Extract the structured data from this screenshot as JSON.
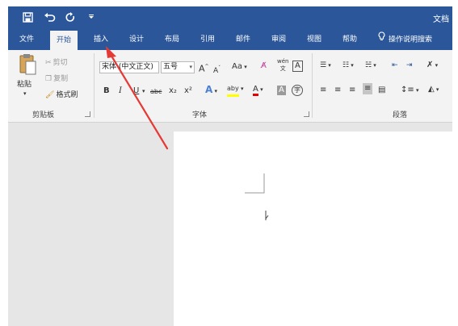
{
  "title_bar": {
    "save_icon": "save-icon",
    "undo_icon": "undo-icon",
    "redo_icon": "redo-icon",
    "customize_icon": "customize-qat-icon",
    "doc_title": "文档"
  },
  "tabs": [
    {
      "label": "文件"
    },
    {
      "label": "开始",
      "active": true
    },
    {
      "label": "插入"
    },
    {
      "label": "设计"
    },
    {
      "label": "布局"
    },
    {
      "label": "引用"
    },
    {
      "label": "邮件"
    },
    {
      "label": "审阅"
    },
    {
      "label": "视图"
    },
    {
      "label": "帮助"
    }
  ],
  "tell_me": {
    "label": "操作说明搜索",
    "icon": "lightbulb-icon"
  },
  "clipboard": {
    "paste": "粘贴",
    "cut": "剪切",
    "copy": "复制",
    "format_painter": "格式刷",
    "group_label": "剪贴板"
  },
  "font": {
    "font_name": "宋体 (中文正文)",
    "font_size": "五号",
    "grow": "A",
    "shrink": "A",
    "change_case": "Aa",
    "phonetic": "wén",
    "char_border": "A",
    "bold": "B",
    "italic": "I",
    "underline": "U",
    "strike": "abc",
    "subscript": "x₂",
    "superscript": "x²",
    "text_effect": "A",
    "highlight": "aby",
    "font_color": "A",
    "char_shading": "A",
    "enclose": "字",
    "group_label": "字体"
  },
  "paragraph": {
    "group_label": "段落"
  },
  "colors": {
    "brand": "#2b579a",
    "ribbon_bg": "#f3f3f3",
    "workspace_bg": "#e6e6e6",
    "annotation_arrow": "#e53935",
    "highlight_yellow": "#ffff00",
    "font_color_red": "#e00000"
  }
}
